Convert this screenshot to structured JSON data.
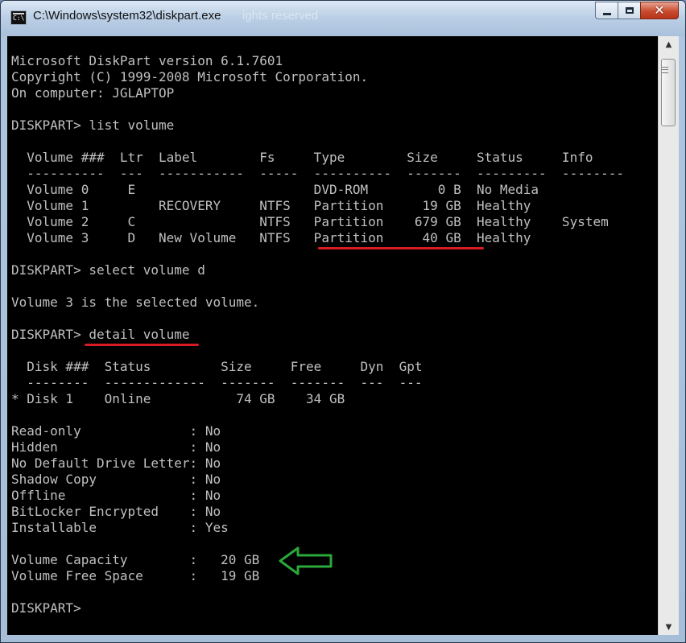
{
  "window": {
    "title": "C:\\Windows\\system32\\diskpart.exe",
    "background_ghost_text": "ights reserved",
    "close_glyph": "✕",
    "accent_close": "#c94b2e"
  },
  "scrollbar": {
    "up_glyph": "▲",
    "down_glyph": "▼"
  },
  "console": {
    "lines": [
      "Microsoft DiskPart version 6.1.7601",
      "Copyright (C) 1999-2008 Microsoft Corporation.",
      "On computer: JGLAPTOP",
      "",
      "DISKPART> list volume",
      "",
      "  Volume ###  Ltr  Label        Fs     Type        Size     Status     Info",
      "  ----------  ---  -----------  -----  ----------  -------  ---------  --------",
      "  Volume 0     E                       DVD-ROM         0 B  No Media",
      "  Volume 1         RECOVERY     NTFS   Partition     19 GB  Healthy",
      "  Volume 2     C                NTFS   Partition    679 GB  Healthy    System",
      "  Volume 3     D   New Volume   NTFS   Partition     40 GB  Healthy",
      "",
      "DISKPART> select volume d",
      "",
      "Volume 3 is the selected volume.",
      "",
      "DISKPART> detail volume",
      "",
      "  Disk ###  Status         Size     Free     Dyn  Gpt",
      "  --------  -------------  -------  -------  ---  ---",
      "* Disk 1    Online           74 GB    34 GB",
      "",
      "Read-only              : No",
      "Hidden                 : No",
      "No Default Drive Letter: No",
      "Shadow Copy            : No",
      "Offline                : No",
      "BitLocker Encrypted    : No",
      "Installable            : Yes",
      "",
      "Volume Capacity        :   20 GB",
      "Volume Free Space      :   19 GB",
      "",
      "DISKPART>"
    ],
    "text_color": "#c0c0c0",
    "background_color": "#000000"
  },
  "annotations": {
    "underline_color": "#d81c23",
    "arrow_color": "#2aa83a"
  }
}
